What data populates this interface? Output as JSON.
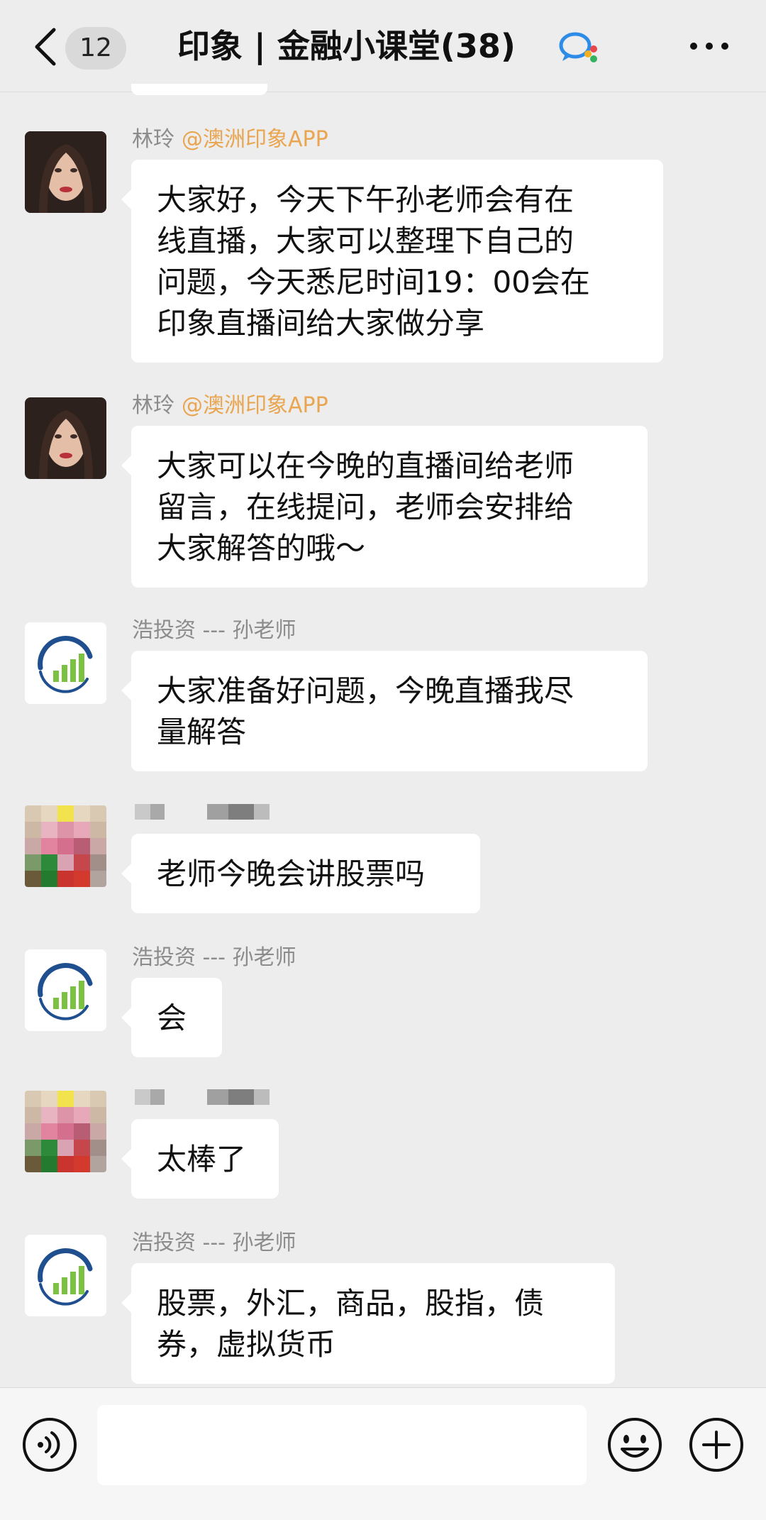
{
  "header": {
    "unread_count": "12",
    "title": "印象 | 金融小课堂(38)",
    "back_icon": "chevron-left-icon",
    "title_icon": "enterprise-chat-icon",
    "more_icon": "more-dots-icon"
  },
  "messages": [
    {
      "sender": "林玲",
      "sender_tag": "@澳洲印象APP",
      "avatar": "woman-portrait",
      "text": "大家好，今天下午孙老师会有在\n线直播，大家可以整理下自己的\n问题，今天悉尼时间19：00会在\n印象直播间给大家做分享"
    },
    {
      "sender": "林玲",
      "sender_tag": "@澳洲印象APP",
      "avatar": "woman-portrait",
      "text": "大家可以在今晚的直播间给老师\n留言，在线提问，老师会安排给\n大家解答的哦～"
    },
    {
      "sender": "浩投资 --- 孙老师",
      "avatar": "growth-chart-logo",
      "text": "大家准备好问题，今晚直播我尽\n量解答"
    },
    {
      "avatar": "pixelated",
      "text": "老师今晚会讲股票吗"
    },
    {
      "sender": "浩投资 --- 孙老师",
      "avatar": "growth-chart-logo",
      "text": "会"
    },
    {
      "avatar": "pixelated",
      "text": "太棒了"
    },
    {
      "sender": "浩投资 --- 孙老师",
      "avatar": "growth-chart-logo",
      "text": "股票，外汇，商品，股指，债\n券，虚拟货币"
    }
  ],
  "input_bar": {
    "voice_icon": "voice-icon",
    "input_value": "",
    "emoji_icon": "emoji-icon",
    "plus_icon": "plus-icon"
  },
  "colors": {
    "background": "#ededed",
    "bubble": "#ffffff",
    "sender_name": "#8c8c8c",
    "sender_tag": "#e9a550",
    "logo_blue": "#1f4f8f",
    "logo_green": "#7cc242"
  }
}
